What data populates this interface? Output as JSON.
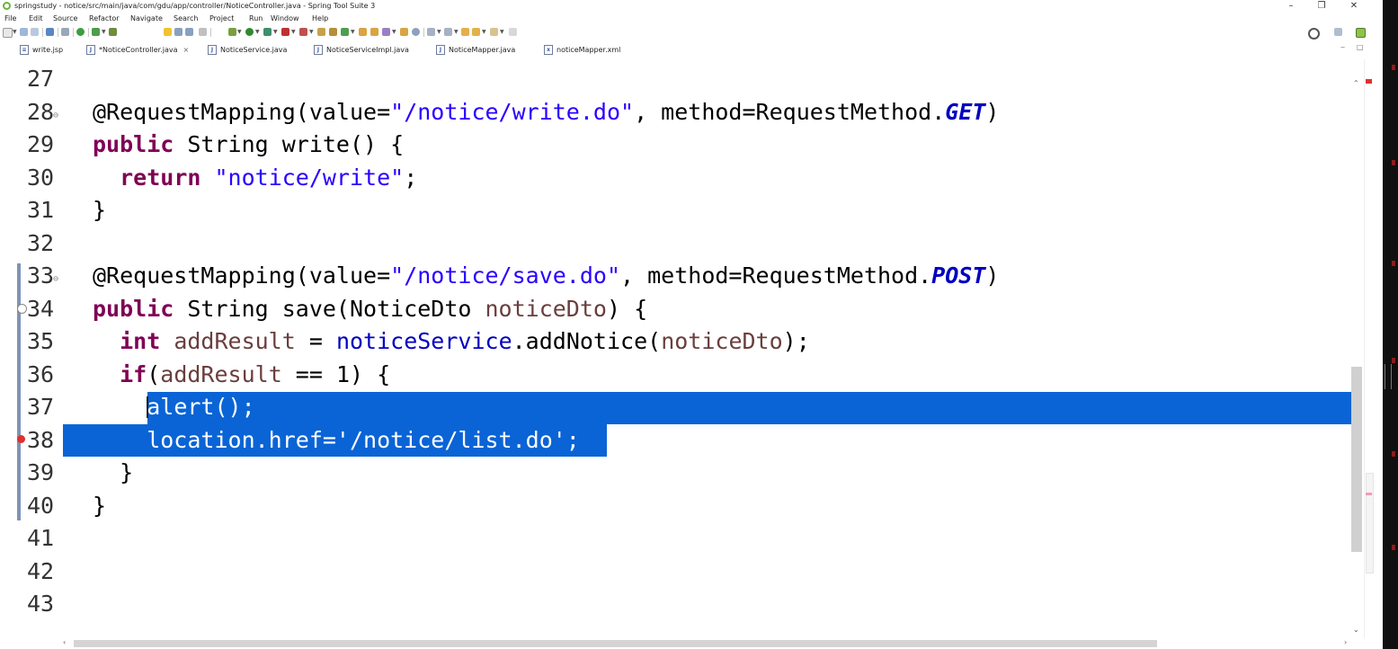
{
  "window": {
    "title": "springstudy - notice/src/main/java/com/gdu/app/controller/NoticeController.java - Spring Tool Suite 3",
    "minimize": "–",
    "restore": "❐",
    "close": "✕"
  },
  "menu": [
    "File",
    "Edit",
    "Source",
    "Refactor",
    "Navigate",
    "Search",
    "Project",
    "Run",
    "Window",
    "Help"
  ],
  "toolbar": {
    "right_icons": [
      "search-icon",
      "perspective-icon",
      "spring-perspective-icon"
    ]
  },
  "tabs": [
    {
      "label": "write.jsp",
      "icon": "jsp-file-icon",
      "active": false
    },
    {
      "label": "*NoticeController.java",
      "icon": "java-file-icon",
      "active": true,
      "close": "×"
    },
    {
      "label": "NoticeService.java",
      "icon": "java-file-icon",
      "active": false
    },
    {
      "label": "NoticeServiceImpl.java",
      "icon": "java-file-icon",
      "active": false
    },
    {
      "label": "NoticeMapper.java",
      "icon": "java-file-icon",
      "active": false
    },
    {
      "label": "noticeMapper.xml",
      "icon": "xml-file-icon",
      "active": false
    }
  ],
  "code": [
    {
      "n": "27",
      "tokens": []
    },
    {
      "n": "28",
      "tokens": [
        [
          "t",
          "@RequestMapping(value="
        ],
        [
          "str",
          "\"/notice/write.do\""
        ],
        [
          "t",
          ", method=RequestMethod."
        ],
        [
          "const",
          "GET"
        ],
        [
          "t",
          ")"
        ]
      ]
    },
    {
      "n": "29",
      "tokens": [
        [
          "kw",
          "public"
        ],
        [
          "t",
          " String write() {"
        ]
      ]
    },
    {
      "n": "30",
      "tokens": [
        [
          "t",
          "  "
        ],
        [
          "kw",
          "return"
        ],
        [
          "t",
          " "
        ],
        [
          "str",
          "\"notice/write\""
        ],
        [
          "t",
          ";"
        ]
      ]
    },
    {
      "n": "31",
      "tokens": [
        [
          "t",
          "}"
        ]
      ]
    },
    {
      "n": "32",
      "tokens": []
    },
    {
      "n": "33",
      "tokens": [
        [
          "t",
          "@RequestMapping(value="
        ],
        [
          "str",
          "\"/notice/save.do\""
        ],
        [
          "t",
          ", method=RequestMethod."
        ],
        [
          "const",
          "POST"
        ],
        [
          "t",
          ")"
        ]
      ]
    },
    {
      "n": "34",
      "tokens": [
        [
          "kw",
          "public"
        ],
        [
          "t",
          " String save(NoticeDto "
        ],
        [
          "var",
          "noticeDto"
        ],
        [
          "t",
          ") {"
        ]
      ]
    },
    {
      "n": "35",
      "tokens": [
        [
          "t",
          "  "
        ],
        [
          "kw",
          "int"
        ],
        [
          "t",
          " "
        ],
        [
          "var",
          "addResult"
        ],
        [
          "t",
          " = "
        ],
        [
          "fld",
          "noticeService"
        ],
        [
          "t",
          ".addNotice("
        ],
        [
          "var",
          "noticeDto"
        ],
        [
          "t",
          ");"
        ]
      ]
    },
    {
      "n": "36",
      "tokens": [
        [
          "t",
          "  "
        ],
        [
          "kw",
          "if"
        ],
        [
          "t",
          "("
        ],
        [
          "var",
          "addResult"
        ],
        [
          "t",
          " == 1) {"
        ]
      ]
    },
    {
      "n": "37",
      "tokens": [
        [
          "t",
          "    "
        ],
        [
          "sel",
          "alert();"
        ]
      ]
    },
    {
      "n": "38",
      "tokens": [
        [
          "sel",
          "    location.href='/notice/list.do';"
        ]
      ]
    },
    {
      "n": "39",
      "tokens": [
        [
          "t",
          "  }"
        ]
      ]
    },
    {
      "n": "40",
      "tokens": [
        [
          "t",
          "}"
        ]
      ]
    },
    {
      "n": "41",
      "tokens": []
    },
    {
      "n": "42",
      "tokens": []
    },
    {
      "n": "43",
      "tokens": []
    }
  ],
  "colors": {
    "selection": "#0a64d6",
    "keyword": "#7f0055",
    "string": "#2a00ff",
    "field": "#0000c0",
    "error": "#e03030"
  }
}
